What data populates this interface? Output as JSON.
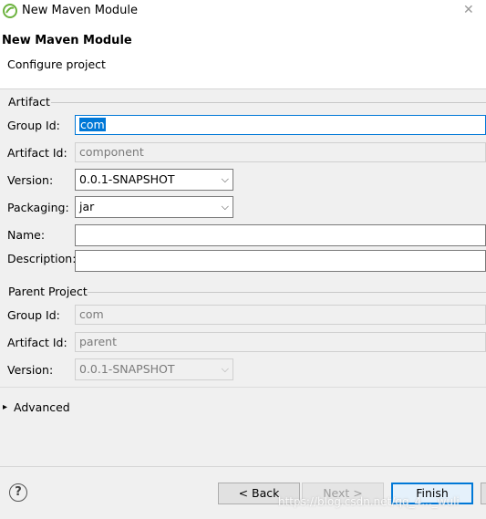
{
  "window": {
    "title": "New Maven Module"
  },
  "header": {
    "title": "New Maven Module",
    "subtitle": "Configure project"
  },
  "artifact": {
    "section_label": "Artifact",
    "group_id_label": "Group Id:",
    "group_id_value": "com",
    "artifact_id_label": "Artifact Id:",
    "artifact_id_value": "component",
    "version_label": "Version:",
    "version_value": "0.0.1-SNAPSHOT",
    "packaging_label": "Packaging:",
    "packaging_value": "jar",
    "name_label": "Name:",
    "name_value": "",
    "description_label": "Description:",
    "description_value": ""
  },
  "parent": {
    "section_label": "Parent Project",
    "group_id_label": "Group Id:",
    "group_id_value": "com",
    "artifact_id_label": "Artifact Id:",
    "artifact_id_value": "parent",
    "version_label": "Version:",
    "version_value": "0.0.1-SNAPSHOT"
  },
  "advanced": {
    "label": "Advanced",
    "expander": "▸"
  },
  "footer": {
    "help_glyph": "?",
    "back_label": "< Back",
    "next_label": "Next >",
    "finish_label": "Finish"
  },
  "watermark": "https://blog.csdn.net/qq_4..._wuli"
}
